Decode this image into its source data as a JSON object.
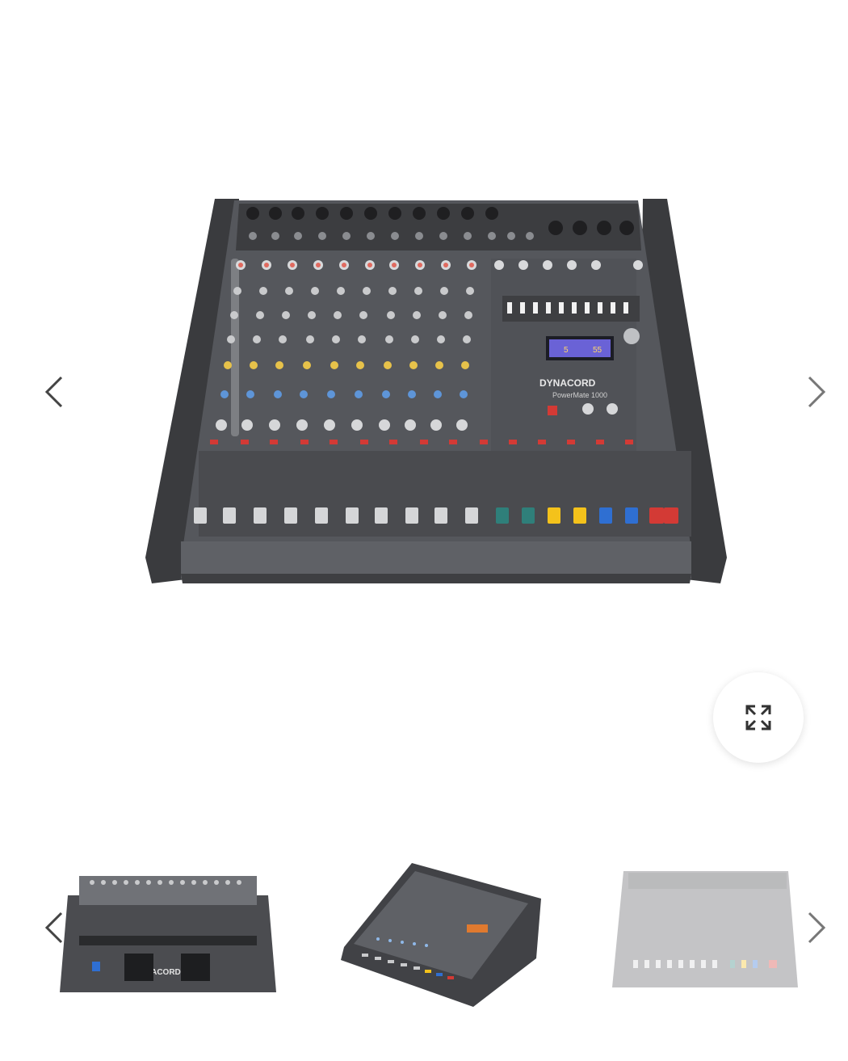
{
  "gallery": {
    "main_image": {
      "alt": "Dynacord PowerMate 1000 powered mixer - front top view",
      "brand_label": "DYNACORD",
      "model_label": "PowerMate 1000"
    },
    "prev_icon": "chevron-left-icon",
    "next_icon": "chevron-right-icon",
    "expand_icon": "expand-icon"
  },
  "thumbnails": {
    "items": [
      {
        "alt": "Rear view",
        "label": "DYNACORD",
        "active": false
      },
      {
        "alt": "Angled top view",
        "active": true
      },
      {
        "alt": "Top view",
        "active": false
      }
    ],
    "prev_icon": "chevron-left-icon",
    "next_icon": "chevron-right-icon"
  },
  "colors": {
    "background": "#ffffff",
    "mixer_body": "#4a4b4f",
    "panel": "#5d5f64",
    "arrow": "#555555",
    "fader_white": "#e8e8e8",
    "fader_teal": "#2f7f7a",
    "fader_yellow": "#f4c21b",
    "fader_blue": "#2f6fd2",
    "fader_red": "#d33a35"
  }
}
